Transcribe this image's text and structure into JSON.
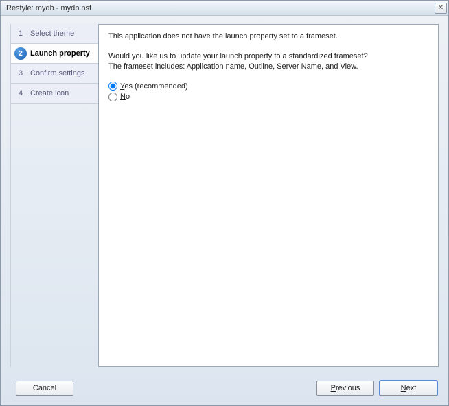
{
  "window": {
    "title": "Restyle: mydb - mydb.nsf"
  },
  "sidebar": {
    "steps": [
      {
        "num": "1",
        "label": "Select theme"
      },
      {
        "num": "2",
        "label": "Launch property"
      },
      {
        "num": "3",
        "label": "Confirm settings"
      },
      {
        "num": "4",
        "label": "Create icon"
      }
    ],
    "activeIndex": 1
  },
  "content": {
    "line1": "This application does not have the launch property set to a frameset.",
    "line2a": "Would you like us to update your launch property to a standardized frameset?",
    "line2b": "The frameset includes: Application name, Outline, Server Name, and View.",
    "optionYes": {
      "text": " (recommended)",
      "key": "Y",
      "rest": "es"
    },
    "optionNo": {
      "key": "N",
      "rest": "o"
    },
    "selected": "yes"
  },
  "buttons": {
    "cancel": "Cancel",
    "previous": {
      "key": "P",
      "rest": "revious"
    },
    "next": {
      "key": "N",
      "rest": "ext"
    }
  }
}
